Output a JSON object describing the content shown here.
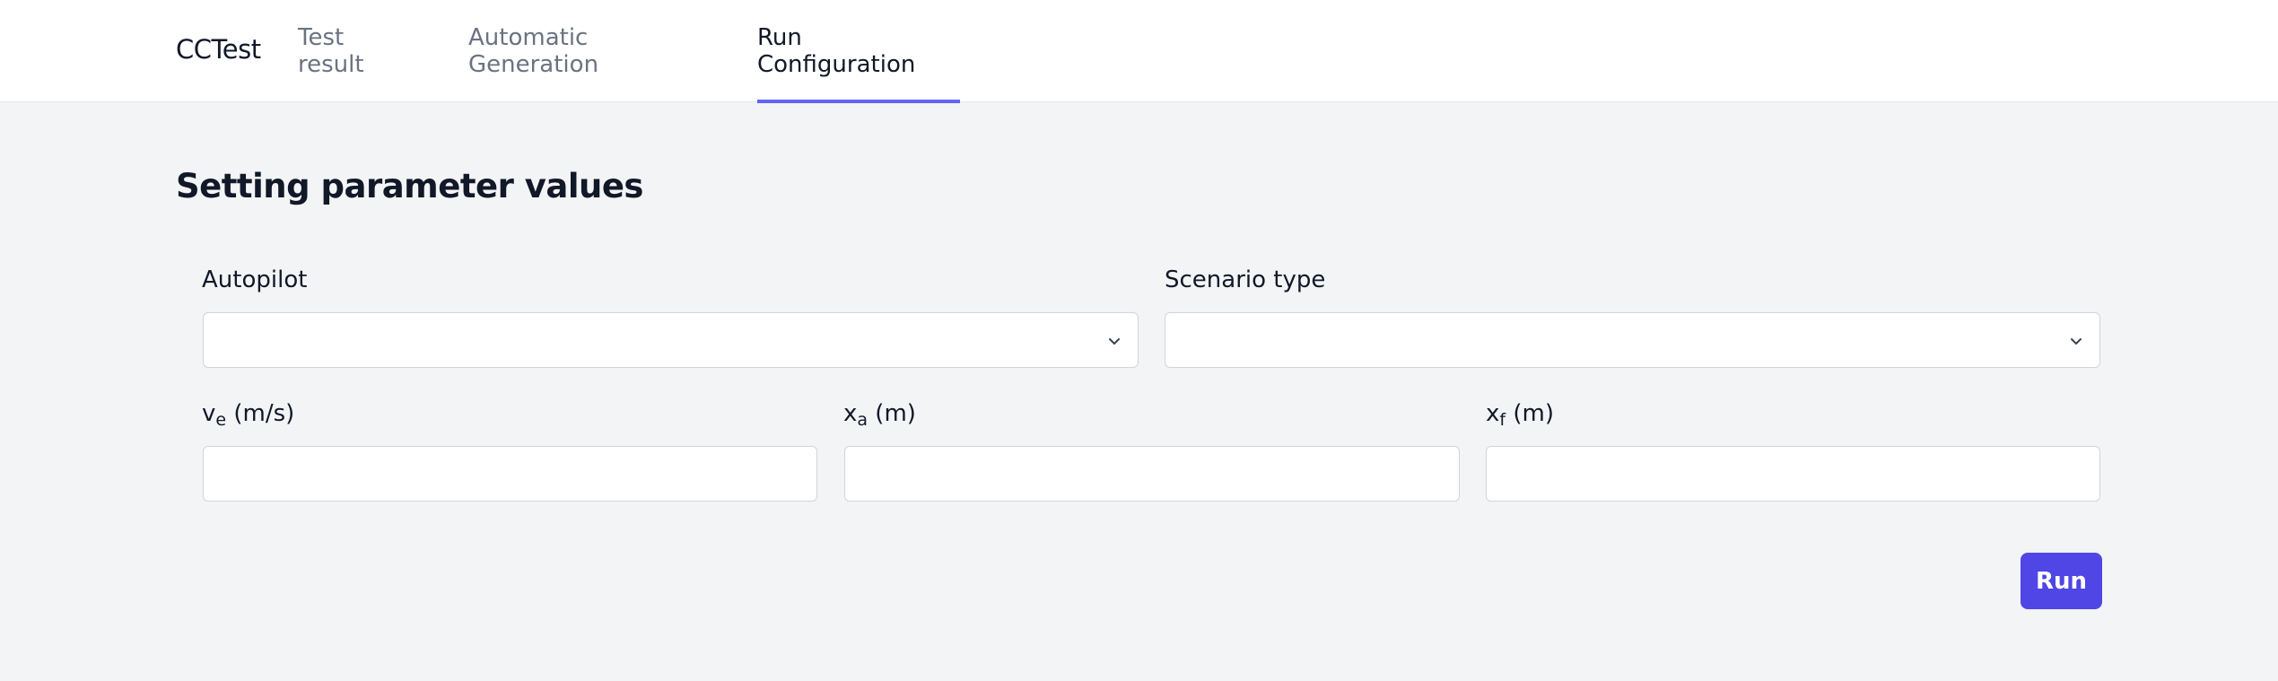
{
  "app": {
    "brand": "CCTest"
  },
  "nav": {
    "tabs": [
      {
        "label": "Test result",
        "active": false
      },
      {
        "label": "Automatic Generation",
        "active": false
      },
      {
        "label": "Run Configuration",
        "active": true
      }
    ]
  },
  "main": {
    "title": "Setting parameter values",
    "autopilot": {
      "label": "Autopilot",
      "value": ""
    },
    "scenario": {
      "label": "Scenario type",
      "value": ""
    },
    "ve": {
      "label_main": "v",
      "label_sub": "e",
      "label_unit": " (m/s)",
      "value": ""
    },
    "xa": {
      "label_main": "x",
      "label_sub": "a",
      "label_unit": " (m)",
      "value": ""
    },
    "xf": {
      "label_main": "x",
      "label_sub": "f",
      "label_unit": " (m)",
      "value": ""
    },
    "run_label": "Run"
  },
  "icons": {
    "select_chevron": "chevron-down-icon"
  },
  "colors": {
    "accent": "#4f46e5",
    "tab_indicator": "#6366f1",
    "background": "#f3f4f6"
  }
}
